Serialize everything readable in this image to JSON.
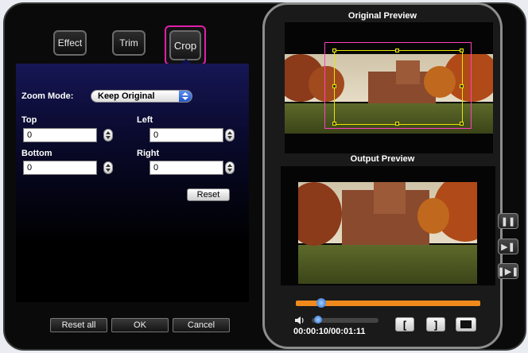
{
  "tabs": [
    {
      "label": "Effect"
    },
    {
      "label": "Trim"
    },
    {
      "label": "Crop",
      "active": true
    }
  ],
  "crop": {
    "zoom_mode_label": "Zoom Mode:",
    "zoom_mode_value": "Keep Original",
    "top_label": "Top",
    "top_value": "0",
    "left_label": "Left",
    "left_value": "0",
    "bottom_label": "Bottom",
    "bottom_value": "0",
    "right_label": "Right",
    "right_value": "0",
    "reset_label": "Reset"
  },
  "footer": {
    "reset_all_label": "Reset all",
    "ok_label": "OK",
    "cancel_label": "Cancel"
  },
  "preview": {
    "original_title": "Original Preview",
    "output_title": "Output Preview",
    "time": "00:00:10/00:01:11",
    "seek_fraction": 0.14
  },
  "colors": {
    "highlight": "#e020a8",
    "crop_box": "#e8e600",
    "seek_bar": "#f08a1c"
  },
  "icons": [
    "speaker-icon",
    "mark-in-icon",
    "mark-out-icon",
    "fullscreen-icon",
    "pause-icon",
    "step-forward-icon",
    "next-frame-icon"
  ]
}
